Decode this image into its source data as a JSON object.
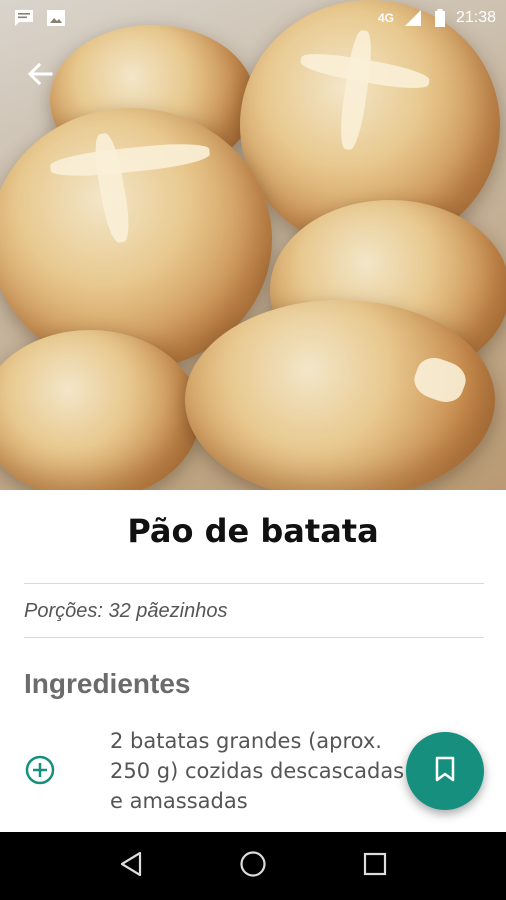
{
  "status_bar": {
    "network": "4G",
    "time": "21:38",
    "icons": [
      "chat-notification-icon",
      "image-notification-icon",
      "signal-icon",
      "battery-icon"
    ]
  },
  "hero": {
    "icon": "back-arrow-icon"
  },
  "recipe": {
    "title": "Pão de batata",
    "portions": "Porções: 32 pãezinhos",
    "ingredients_heading": "Ingredientes",
    "ingredients": [
      {
        "line1": "2 batatas grandes (aprox.",
        "line2": "250 g) cozidas descascadas",
        "line3": "e amassadas",
        "action_icon": "add-circle-icon"
      }
    ]
  },
  "fab": {
    "icon": "bookmark-icon"
  },
  "nav": {
    "icons": [
      "back-triangle-icon",
      "home-circle-icon",
      "recents-square-icon"
    ]
  },
  "colors": {
    "accent": "#178f7e",
    "text": "#111111",
    "muted": "#555555"
  }
}
